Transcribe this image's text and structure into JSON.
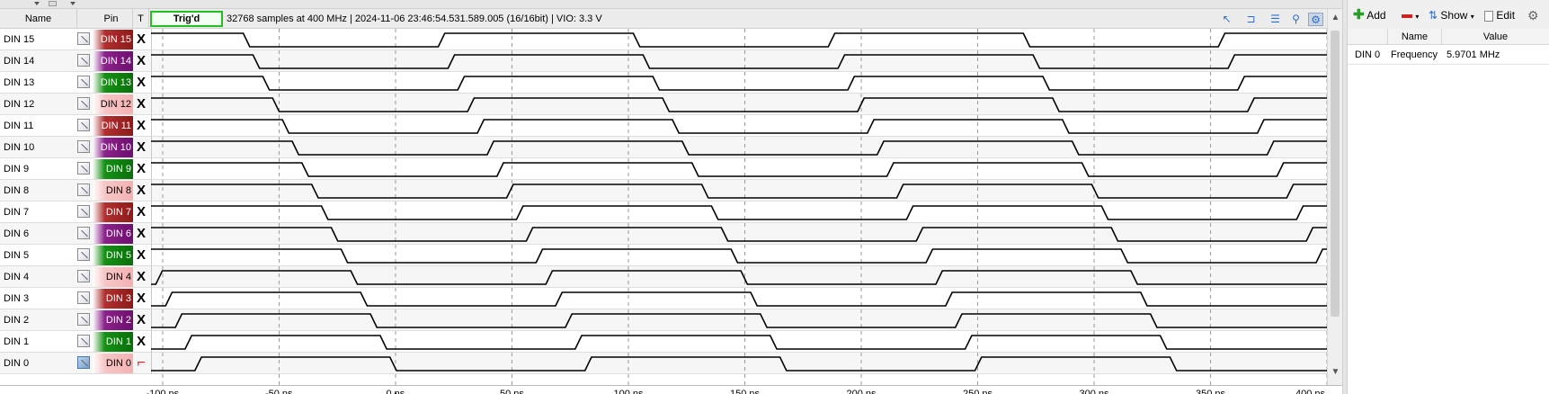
{
  "header": {
    "col_name": "Name",
    "col_pin": "Pin",
    "col_trigger": "T",
    "status": "Trig'd",
    "info": "32768 samples at 400 MHz | 2024-11-06 23:46:54.531.589.005 (16/16bit) | VIO: 3.3 V"
  },
  "toolbar_icons": [
    "cursor-icon",
    "marker-icon",
    "ruler-icon",
    "zoom-icon",
    "zoom-fit-icon"
  ],
  "channels": [
    {
      "name": "DIN 15",
      "pin": "DIN 15",
      "color": "red",
      "trigger": "X"
    },
    {
      "name": "DIN 14",
      "pin": "DIN 14",
      "color": "purple",
      "trigger": "X"
    },
    {
      "name": "DIN 13",
      "pin": "DIN 13",
      "color": "green",
      "trigger": "X"
    },
    {
      "name": "DIN 12",
      "pin": "DIN 12",
      "color": "pink",
      "trigger": "X"
    },
    {
      "name": "DIN 11",
      "pin": "DIN 11",
      "color": "red",
      "trigger": "X"
    },
    {
      "name": "DIN 10",
      "pin": "DIN 10",
      "color": "purple",
      "trigger": "X"
    },
    {
      "name": "DIN 9",
      "pin": "DIN  9",
      "color": "green",
      "trigger": "X"
    },
    {
      "name": "DIN 8",
      "pin": "DIN  8",
      "color": "pink",
      "trigger": "X"
    },
    {
      "name": "DIN 7",
      "pin": "DIN  7",
      "color": "red",
      "trigger": "X"
    },
    {
      "name": "DIN 6",
      "pin": "DIN  6",
      "color": "purple",
      "trigger": "X"
    },
    {
      "name": "DIN 5",
      "pin": "DIN  5",
      "color": "green",
      "trigger": "X"
    },
    {
      "name": "DIN 4",
      "pin": "DIN  4",
      "color": "pink",
      "trigger": "X"
    },
    {
      "name": "DIN 3",
      "pin": "DIN  3",
      "color": "red",
      "trigger": "X"
    },
    {
      "name": "DIN 2",
      "pin": "DIN  2",
      "color": "purple",
      "trigger": "X"
    },
    {
      "name": "DIN 1",
      "pin": "DIN  1",
      "color": "green",
      "trigger": "X"
    },
    {
      "name": "DIN 0",
      "pin": "DIN  0",
      "color": "pink",
      "trigger": "falling-edge"
    }
  ],
  "timeline": {
    "range_ns": [
      -105,
      400
    ],
    "ticks": [
      "-100 ns",
      "-50 ns",
      "0 ns",
      "50 ns",
      "100 ns",
      "150 ns",
      "200 ns",
      "250 ns",
      "300 ns",
      "350 ns",
      "400 ns"
    ],
    "tick_values": [
      -100,
      -50,
      0,
      50,
      100,
      150,
      200,
      250,
      300,
      350,
      400
    ],
    "trigger_ns": 0
  },
  "waveforms": {
    "period_ns": 167.5,
    "din0_falling_edge_ns": -1,
    "bit_delay_ns": 4.2,
    "transition_ns": 2.8
  },
  "measurements_panel": {
    "toolbar": {
      "add": "Add",
      "show": "Show",
      "edit": "Edit"
    },
    "columns": [
      "Name",
      "Value"
    ],
    "rows": [
      {
        "channel": "DIN 0",
        "name": "Frequency",
        "value": "5.9701 MHz"
      }
    ]
  },
  "colors": {
    "pin_red": "#8e1a1a",
    "pin_purple": "#6e0f6e",
    "pin_green": "#0a6f0a",
    "pin_pink": "#f4b2b2",
    "trig_box": "#22c022",
    "trigger_edge": "#e02020"
  }
}
